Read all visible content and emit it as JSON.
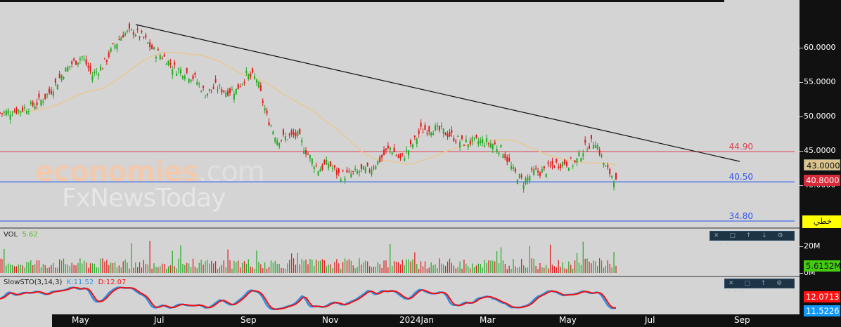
{
  "price_axis": {
    "ticks": [
      "60.0000",
      "55.0000",
      "50.0000",
      "45.0000",
      "40.0000"
    ],
    "tick_values": [
      60,
      55,
      50,
      45,
      40
    ]
  },
  "tags": {
    "ma": "43.0000",
    "last": "40.8000",
    "line_label": "خطي"
  },
  "levels": [
    {
      "label": "44.90",
      "value": 44.9,
      "color": "#e04050"
    },
    {
      "label": "40.50",
      "value": 40.5,
      "color": "#2255ee"
    },
    {
      "label": "34.80",
      "value": 34.8,
      "color": "#2255ee"
    }
  ],
  "watermark": {
    "brand1": "economies",
    "brand1_suffix": ".com",
    "brand2": "FxNewsToday"
  },
  "volume": {
    "title": "VOL",
    "value": "5.62",
    "ticks": [
      "20M",
      "0M"
    ],
    "tag": "5.6152M"
  },
  "stoch": {
    "title": "SlowSTO(3,14,3)",
    "k": "K:11.52",
    "d": "D:12.07",
    "k_tag": "11.5226",
    "d_tag": "12.0713"
  },
  "panel_toolbar": "✕ ▢ ↑ ↓ ⚙ ···",
  "panel_toolbar2": "✕ ▢ ↑ ⚙ ···",
  "x_axis": [
    "May",
    "Jul",
    "Sep",
    "Nov",
    "2024Jan",
    "Mar",
    "May",
    "Jul",
    "Sep"
  ],
  "colors": {
    "up": "#22aa22",
    "down": "#e01818",
    "ma": "#e8c890",
    "k": "#2d8fe8",
    "d": "#ee1111"
  },
  "chart_data": {
    "type": "candlestick",
    "weekly_close": [
      50.5,
      50.7,
      51,
      51.5,
      52.3,
      53.8,
      56,
      57.7,
      58.7,
      56,
      57.3,
      60,
      62,
      62.4,
      61.4,
      59.5,
      58.6,
      57,
      56.5,
      55.5,
      53.3,
      54.3,
      53.7,
      53.8,
      56,
      55.5,
      50,
      46.7,
      47,
      47.3,
      44.5,
      42.3,
      43.2,
      41.5,
      41.5,
      42,
      42.3,
      43.7,
      45.5,
      43.7,
      45.5,
      48,
      48.3,
      47.9,
      47.2,
      46.2,
      46.3,
      46.4,
      46,
      45,
      42,
      40.5,
      41.9,
      42,
      43,
      43.3,
      43.2,
      45.5,
      46.5,
      42.5,
      40.8
    ],
    "trendline": {
      "from_price": 63.2,
      "to_price": 43.3
    },
    "ylim": [
      33,
      68
    ],
    "last": 40.8,
    "ma_last": 43.0
  }
}
